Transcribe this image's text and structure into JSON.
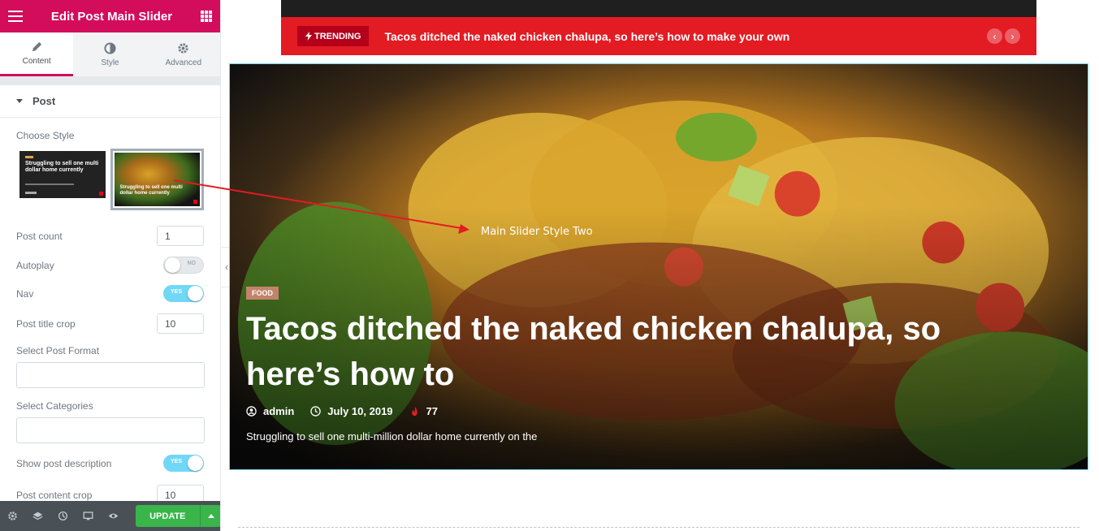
{
  "panel": {
    "title": "Edit Post Main Slider",
    "tabs": [
      {
        "label": "Content",
        "icon": "pencil-icon"
      },
      {
        "label": "Style",
        "icon": "contrast-icon"
      },
      {
        "label": "Advanced",
        "icon": "gear-icon"
      }
    ],
    "section": "Post",
    "choose_style_label": "Choose Style",
    "style_options": [
      {
        "thumb_text": "Struggling to sell one multi dollar home currently"
      },
      {
        "thumb_text": "Struggling to sell one multi dollar home currently"
      }
    ],
    "post_count": {
      "label": "Post count",
      "value": "1"
    },
    "autoplay": {
      "label": "Autoplay",
      "state": "NO"
    },
    "nav": {
      "label": "Nav",
      "state": "YES"
    },
    "post_title_crop": {
      "label": "Post title crop",
      "value": "10"
    },
    "select_post_format": {
      "label": "Select Post Format",
      "value": ""
    },
    "select_categories": {
      "label": "Select Categories",
      "value": ""
    },
    "show_post_description": {
      "label": "Show post description",
      "state": "YES"
    },
    "post_content_crop": {
      "label": "Post content crop",
      "value": "10"
    }
  },
  "footer": {
    "icons": [
      "settings-icon",
      "layers-icon",
      "history-icon",
      "responsive-icon",
      "preview-eye-icon"
    ],
    "update_label": "UPDATE"
  },
  "preview": {
    "trending": {
      "badge": "TRENDING",
      "headline": "Tacos ditched the naked chicken chalupa, so here’s how to make your own"
    },
    "slide": {
      "category": "FOOD",
      "title": "Tacos ditched the naked chicken chalupa, so here’s how to",
      "author": "admin",
      "date": "July 10, 2019",
      "views": "77",
      "description": "Struggling to sell one multi-million dollar home currently on the"
    },
    "annotation": "Main Slider Style Two"
  },
  "colors": {
    "brand": "#d30c5c",
    "trending_bar": "#e31b23",
    "update_green": "#39b54a",
    "toggle_on": "#71d7f7",
    "category_badge": "#c1836a"
  }
}
